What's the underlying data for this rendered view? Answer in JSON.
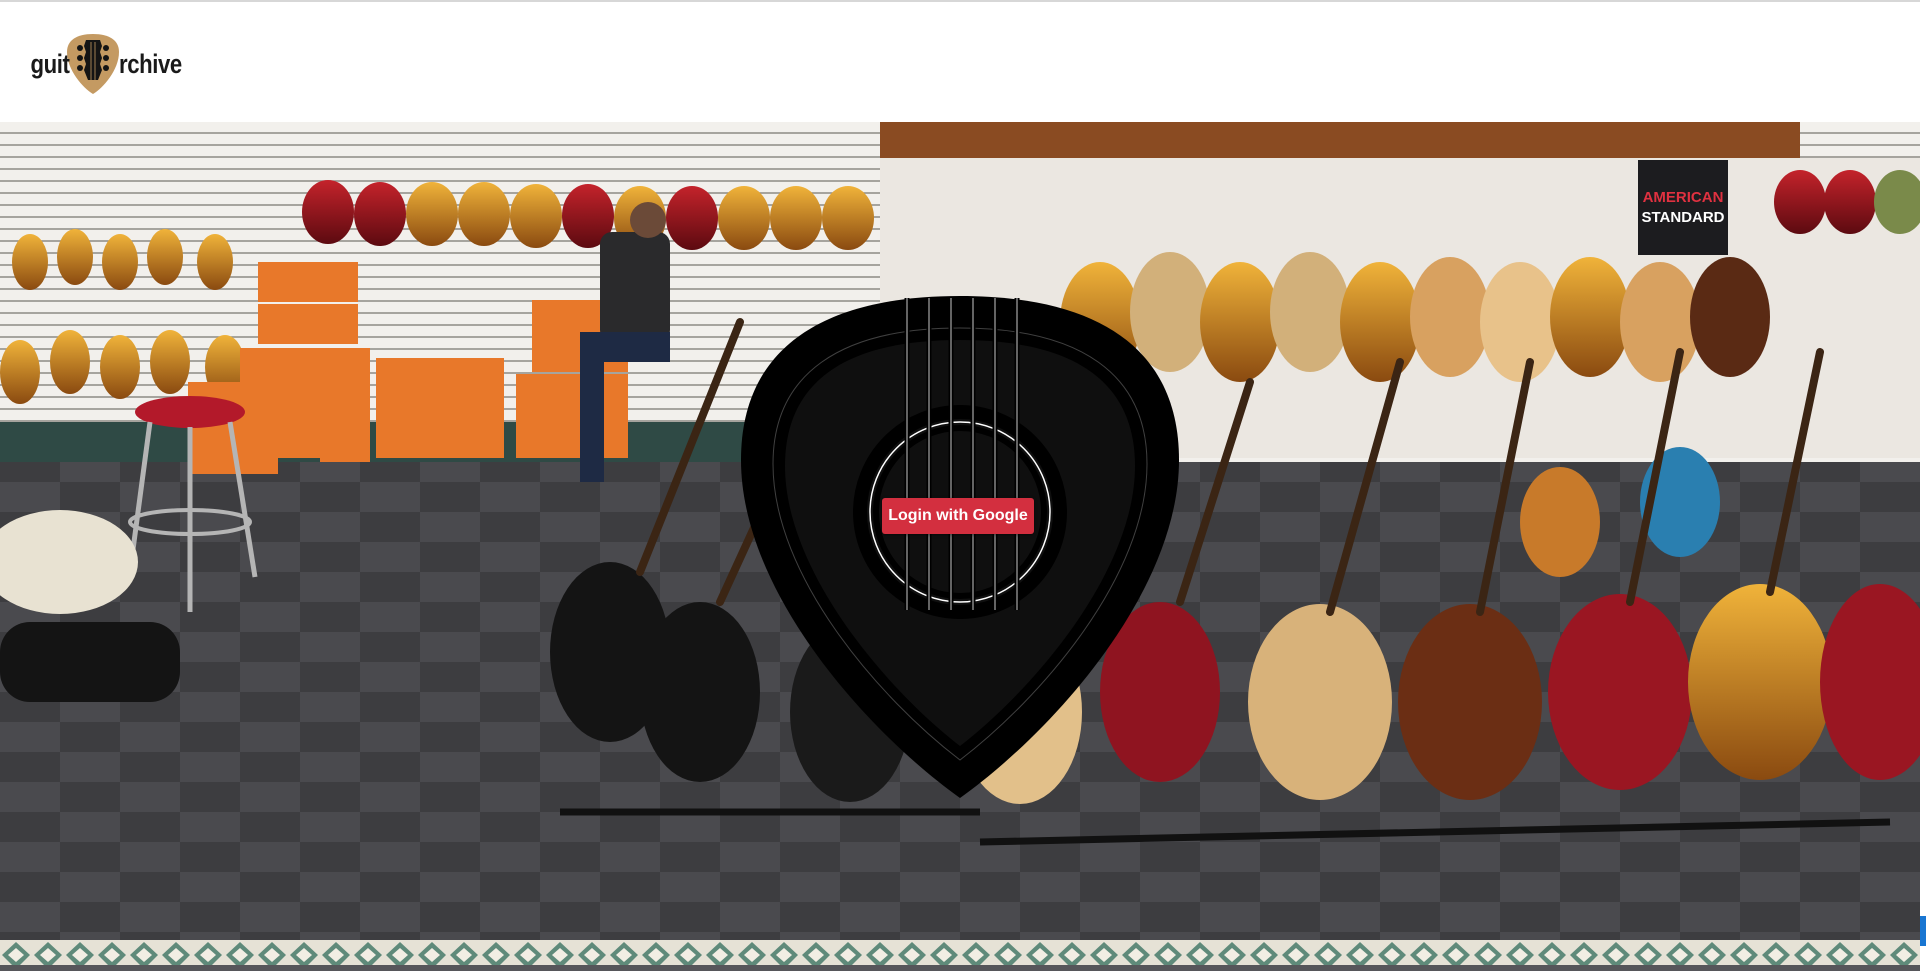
{
  "header": {
    "logo_text_left": "guit",
    "logo_text_right": "rchive",
    "logo_icon": "guitar-pick-headstock-icon"
  },
  "hero": {
    "background": "guitar-store-photo",
    "overlay_icon": "guitar-pick-soundhole-icon"
  },
  "auth": {
    "login_label": "Login with Google",
    "button_color": "#d32f3f"
  },
  "colors": {
    "header_bg": "#ffffff",
    "pick_fill": "#000000",
    "scroll_accent": "#1976d2"
  }
}
